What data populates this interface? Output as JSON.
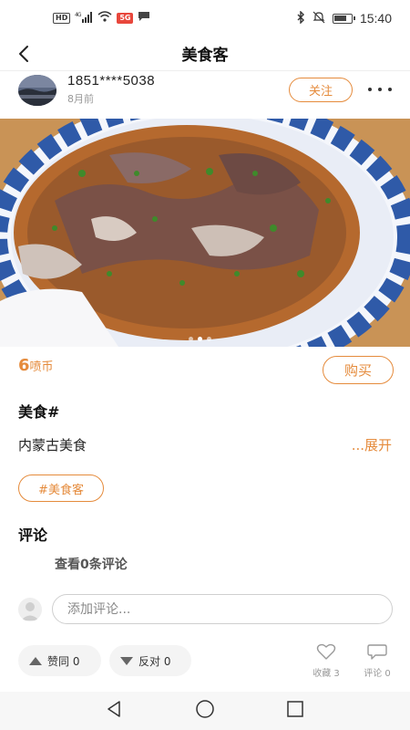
{
  "status_bar": {
    "left_badges": [
      "HD",
      "4G",
      "",
      "",
      "5G"
    ],
    "time": "15:40"
  },
  "nav": {
    "title": "美食客"
  },
  "author": {
    "name": "1851****5038",
    "time": "8月前",
    "follow_label": "关注"
  },
  "hero": {
    "slide_count": 3,
    "active_slide": 1
  },
  "price": {
    "amount": "6",
    "unit": "喷币",
    "buy_label": "购买"
  },
  "post": {
    "title": "美食#",
    "body": "内蒙古美食",
    "expand_label": "...展开",
    "tag": "#美食客"
  },
  "comments": {
    "heading": "评论",
    "view_all": "查看0条评论",
    "input_placeholder": "添加评论..."
  },
  "actions": {
    "upvote_label": "赞同 0",
    "downvote_label": "反对 0",
    "favorite_label": "收藏 3",
    "comment_label": "评论 0"
  },
  "colors": {
    "accent": "#e58b3c",
    "text": "#222222",
    "muted": "#999999"
  }
}
